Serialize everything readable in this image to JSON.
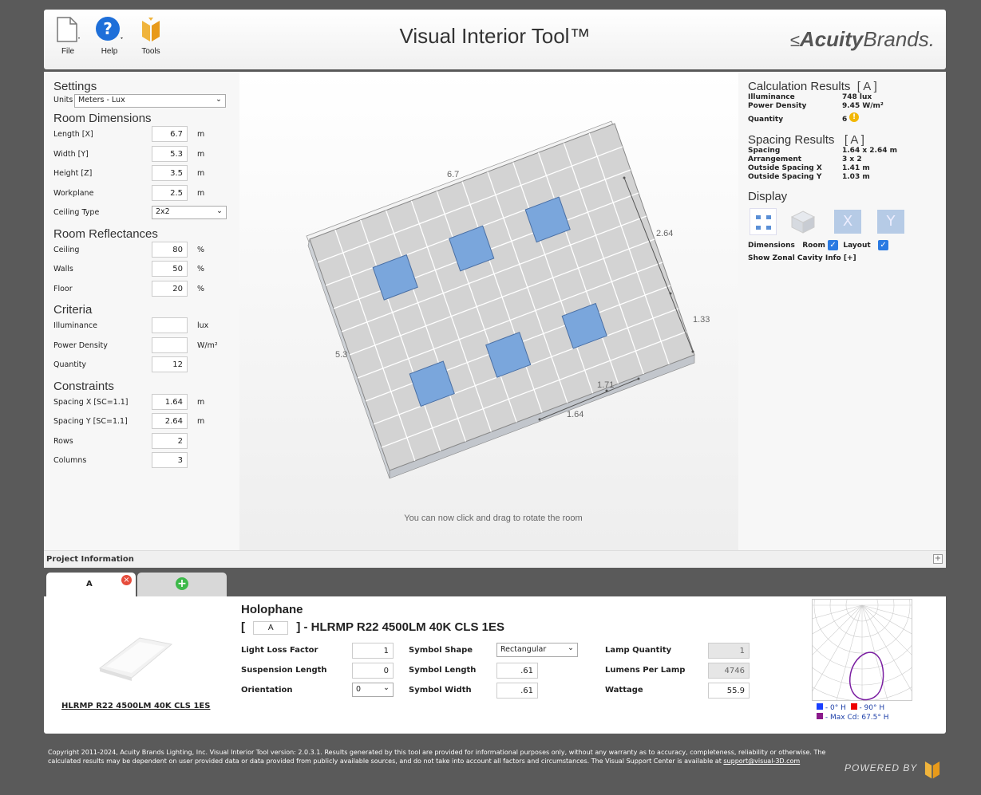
{
  "toolbar": {
    "file": "File",
    "help": "Help",
    "tools": "Tools"
  },
  "app_title": "Visual Interior Tool™",
  "brand": {
    "bold": "Acuity",
    "rest": "Brands."
  },
  "settings": {
    "title": "Settings",
    "units_label": "Units",
    "units_value": "Meters - Lux"
  },
  "room_dimensions": {
    "title": "Room Dimensions",
    "rows": [
      {
        "label": "Length [X]",
        "value": "6.7",
        "unit": "m"
      },
      {
        "label": "Width [Y]",
        "value": "5.3",
        "unit": "m"
      },
      {
        "label": "Height [Z]",
        "value": "3.5",
        "unit": "m"
      },
      {
        "label": "Workplane",
        "value": "2.5",
        "unit": "m"
      }
    ],
    "ceiling_type_label": "Ceiling Type",
    "ceiling_type_value": "2x2"
  },
  "reflectances": {
    "title": "Room Reflectances",
    "rows": [
      {
        "label": "Ceiling",
        "value": "80",
        "unit": "%"
      },
      {
        "label": "Walls",
        "value": "50",
        "unit": "%"
      },
      {
        "label": "Floor",
        "value": "20",
        "unit": "%"
      }
    ]
  },
  "criteria": {
    "title": "Criteria",
    "rows": [
      {
        "label": "Illuminance",
        "value": "",
        "unit": "lux"
      },
      {
        "label": "Power Density",
        "value": "",
        "unit": "W/m²"
      },
      {
        "label": "Quantity",
        "value": "12",
        "unit": ""
      }
    ]
  },
  "constraints": {
    "title": "Constraints",
    "rows": [
      {
        "label": "Spacing X  [SC=1.1]",
        "value": "1.64",
        "unit": "m"
      },
      {
        "label": "Spacing Y  [SC=1.1]",
        "value": "2.64",
        "unit": "m"
      },
      {
        "label": "Rows",
        "value": "2",
        "unit": ""
      },
      {
        "label": "Columns",
        "value": "3",
        "unit": ""
      }
    ]
  },
  "viewer": {
    "dim_length": "6.7",
    "dim_width": "5.3",
    "dim_spacing_y": "2.64",
    "dim_outside_y": "1.33",
    "dim_outside_x": "1.71",
    "dim_spacing_x": "1.64",
    "hint": "You can now click and drag to rotate the room"
  },
  "calc_results": {
    "title": "Calculation Results",
    "tag": "[ A ]",
    "illuminance_label": "Illuminance",
    "illuminance_value": "748  lux",
    "power_label": "Power Density",
    "power_value": "9.45  W/m²",
    "quantity_label": "Quantity",
    "quantity_value": "6"
  },
  "spacing_results": {
    "title": "Spacing Results",
    "tag": "[ A ]",
    "rows": [
      {
        "label": "Spacing",
        "value": "1.64 x 2.64  m"
      },
      {
        "label": "Arrangement",
        "value": "3 x 2"
      },
      {
        "label": "Outside Spacing X",
        "value": "1.41  m"
      },
      {
        "label": "Outside Spacing Y",
        "value": "1.03  m"
      }
    ]
  },
  "display": {
    "title": "Display",
    "dimensions_label": "Dimensions",
    "room_label": "Room",
    "layout_label": "Layout",
    "zonal_label": "Show Zonal Cavity Info [+]"
  },
  "project_info": "Project Information",
  "tabs": {
    "a_label": "A"
  },
  "luminaire": {
    "manufacturer": "Holophane",
    "tag_value": "A",
    "name_suffix": "] - HLRMP R22 4500LM 40K CLS 1ES",
    "bracket_open": "[",
    "product_link": "HLRMP R22 4500LM 40K CLS 1ES",
    "llf_label": "Light Loss Factor",
    "llf_value": "1",
    "suspension_label": "Suspension Length",
    "suspension_value": "0",
    "orientation_label": "Orientation",
    "orientation_value": "0",
    "shape_label": "Symbol Shape",
    "shape_value": "Rectangular",
    "sym_length_label": "Symbol Length",
    "sym_length_value": ".61",
    "sym_width_label": "Symbol Width",
    "sym_width_value": ".61",
    "lamp_qty_label": "Lamp Quantity",
    "lamp_qty_value": "1",
    "lumens_label": "Lumens Per Lamp",
    "lumens_value": "4746",
    "wattage_label": "Wattage",
    "wattage_value": "55.9"
  },
  "polar_legend": {
    "blue": "- 0° H",
    "red": "- 90° H",
    "purple": "- Max Cd: 67.5° H"
  },
  "footer": {
    "text": "Copyright 2011-2024, Acuity Brands Lighting, Inc. Visual Interior Tool version: 2.0.3.1. Results generated by this tool are provided for informational purposes only, without any warranty as to accuracy, completeness, reliability or otherwise. The calculated results may be dependent on user provided data or data provided from publicly available sources, and do not take into account all factors and circumstances. The Visual Support Center is available at ",
    "email": "support@visual-3D.com",
    "powered": "POWERED BY"
  },
  "colors": {
    "accent": "#2a7ae2",
    "fixture": "#7aa6dc",
    "floor": "#d3d3d3"
  }
}
